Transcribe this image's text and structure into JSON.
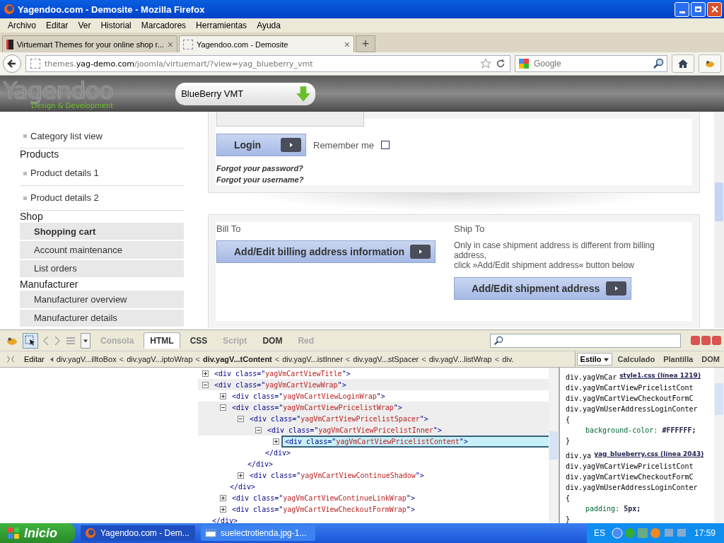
{
  "window": {
    "title": "Yagendoo.com - Demosite - Mozilla Firefox"
  },
  "menu": [
    "Archivo",
    "Editar",
    "Ver",
    "Historial",
    "Marcadores",
    "Herramientas",
    "Ayuda"
  ],
  "tabs": [
    {
      "label": "Virtuemart Themes for your online shop r...",
      "selected": false,
      "close": "×"
    },
    {
      "label": "Yagendoo.com - Demosite",
      "selected": true,
      "close": "×"
    }
  ],
  "new_tab": "+",
  "address": {
    "prefix": "themes.",
    "host": "yag-demo.com",
    "path": "/joomla/virtuemart/?view=yag_blueberry_vmt"
  },
  "search": {
    "placeholder": "Google"
  },
  "site": {
    "logo": "Yagendoo",
    "logo_tagline": "Design & Development",
    "theme_select": "BlueBerry VMT"
  },
  "sidebar": [
    {
      "kind": "bullet",
      "label": "Category list view",
      "selected": false
    },
    {
      "kind": "heading",
      "label": "Products",
      "selected": false
    },
    {
      "kind": "bullet",
      "label": "Product details 1",
      "selected": false
    },
    {
      "kind": "bullet",
      "label": "Product details 2",
      "selected": false
    },
    {
      "kind": "heading",
      "label": "Shop",
      "selected": false
    },
    {
      "kind": "box",
      "label": "Shopping cart",
      "selected": true
    },
    {
      "kind": "box",
      "label": "Account maintenance",
      "selected": false
    },
    {
      "kind": "box",
      "label": "List orders",
      "selected": false
    },
    {
      "kind": "heading",
      "label": "Manufacturer",
      "selected": false
    },
    {
      "kind": "box",
      "label": "Manufacturer overview",
      "selected": false
    },
    {
      "kind": "box",
      "label": "Manufacturer details",
      "selected": false
    }
  ],
  "login": {
    "button": "Login",
    "remember": "Remember me",
    "remember_checked": false,
    "forgot_password": "Forgot your password?",
    "forgot_username": "Forgot your username?"
  },
  "address_panel": {
    "bill_to": "Bill To",
    "bill_button": "Add/Edit billing address information",
    "ship_to": "Ship To",
    "ship_note": "Only in case shipment address is different from billing address,",
    "ship_note_2": "click »Add/Edit shipment address« button below",
    "ship_button": "Add/Edit shipment address"
  },
  "devtools": {
    "tabs": [
      {
        "label": "Consola",
        "selected": false,
        "disabled": true
      },
      {
        "label": "HTML",
        "selected": true,
        "disabled": false
      },
      {
        "label": "CSS",
        "selected": false,
        "disabled": false
      },
      {
        "label": "Script",
        "selected": false,
        "disabled": true
      },
      {
        "label": "DOM",
        "selected": false,
        "disabled": false
      },
      {
        "label": "Red",
        "selected": false,
        "disabled": true
      }
    ],
    "edit": "Editar",
    "breadcrumb": [
      {
        "text": "div.yagV...illtoBox",
        "selected": false
      },
      {
        "sep": "<",
        "text": "div.yagV...iptoWrap",
        "selected": false
      },
      {
        "sep": "<",
        "text": "div.yagV...tContent",
        "selected": true
      },
      {
        "sep": "<",
        "text": "div.yagV...istInner",
        "selected": false
      },
      {
        "sep": "<",
        "text": "div.yagV...stSpacer",
        "selected": false
      },
      {
        "sep": "<",
        "text": "div.yagV...listWrap",
        "selected": false
      },
      {
        "sep": "<",
        "text": "div.",
        "selected": false
      }
    ],
    "side_tabs": [
      {
        "label": "Estilo",
        "selected": true
      },
      {
        "label": "Calculado",
        "selected": false
      },
      {
        "label": "Plantilla",
        "selected": false
      },
      {
        "label": "DOM",
        "selected": false
      }
    ],
    "tree": [
      {
        "pre": "<div class=\"",
        "value": "yagVmCartViewTitle",
        "post": "\">",
        "expanded": false,
        "selected": false
      },
      {
        "pre": "<div class=\"",
        "value": "yagVmCartViewWrap",
        "post": "\">",
        "expanded": true,
        "selected": false,
        "close": "</div>",
        "children": [
          {
            "pre": "<div class=\"",
            "value": "yagVmCartViewLoginWrap",
            "post": "\">",
            "expanded": false,
            "selected": false
          },
          {
            "pre": "<div class=\"",
            "value": "yagVmCartViewPricelistWrap",
            "post": "\">",
            "expanded": true,
            "selected": false,
            "close": "</div>",
            "children": [
              {
                "pre": "<div class=\"",
                "value": "yagVmCartViewPricelistSpacer",
                "post": "\">",
                "expanded": true,
                "selected": false,
                "close": "</div>",
                "children": [
                  {
                    "pre": "<div class=\"",
                    "value": "yagVmCartViewPricelistInner",
                    "post": "\">",
                    "expanded": true,
                    "selected": false,
                    "close": "</div>",
                    "children": [
                      {
                        "pre": "<div class=\"",
                        "value": "yagVmCartViewPricelistContent",
                        "post": "\">",
                        "expanded": false,
                        "selected": true
                      }
                    ]
                  }
                ]
              },
              {
                "pre": "<div class=\"",
                "value": "yagVmCartViewContinueShadow",
                "post": "\">",
                "expanded": false,
                "selected": false
              }
            ]
          },
          {
            "pre": "<div class=\"",
            "value": "yagVmCartViewContinueLinkWrap",
            "post": "\">",
            "expanded": false,
            "selected": false
          },
          {
            "pre": "<div class=\"",
            "value": "yagVmCartViewCheckoutFormWrap",
            "post": "\">",
            "expanded": false,
            "selected": false
          }
        ]
      }
    ],
    "rules": [
      {
        "source": "style1.css (línea 1219)",
        "selectors": [
          "div.yagVmCar",
          "div.yagVmCartViewPricelistCont",
          "div.yagVmCartViewCheckoutFormC",
          "div.yagVmUserAddressLoginConter"
        ],
        "open": "{",
        "property": "background-color:",
        "value": "#FFFFFF;",
        "close": "}"
      },
      {
        "source": "yag_blueberry.css (línea 2043)",
        "selectors": [
          "div.ya",
          "div.yagVmCartViewPricelistCont",
          "div.yagVmCartViewCheckoutFormC",
          "div.yagVmUserAddressLoginConter"
        ],
        "open": "{",
        "property": "padding:",
        "value": "5px;",
        "close": "}"
      }
    ]
  },
  "taskbar": {
    "start": "Inicio",
    "tasks": [
      {
        "label": "Yagendoo.com - Dem...",
        "selected": true,
        "kind": "browser"
      },
      {
        "label": "suelectrotienda.jpg-1...",
        "selected": false,
        "kind": "image"
      }
    ],
    "language": "ES",
    "time": "17:59"
  }
}
